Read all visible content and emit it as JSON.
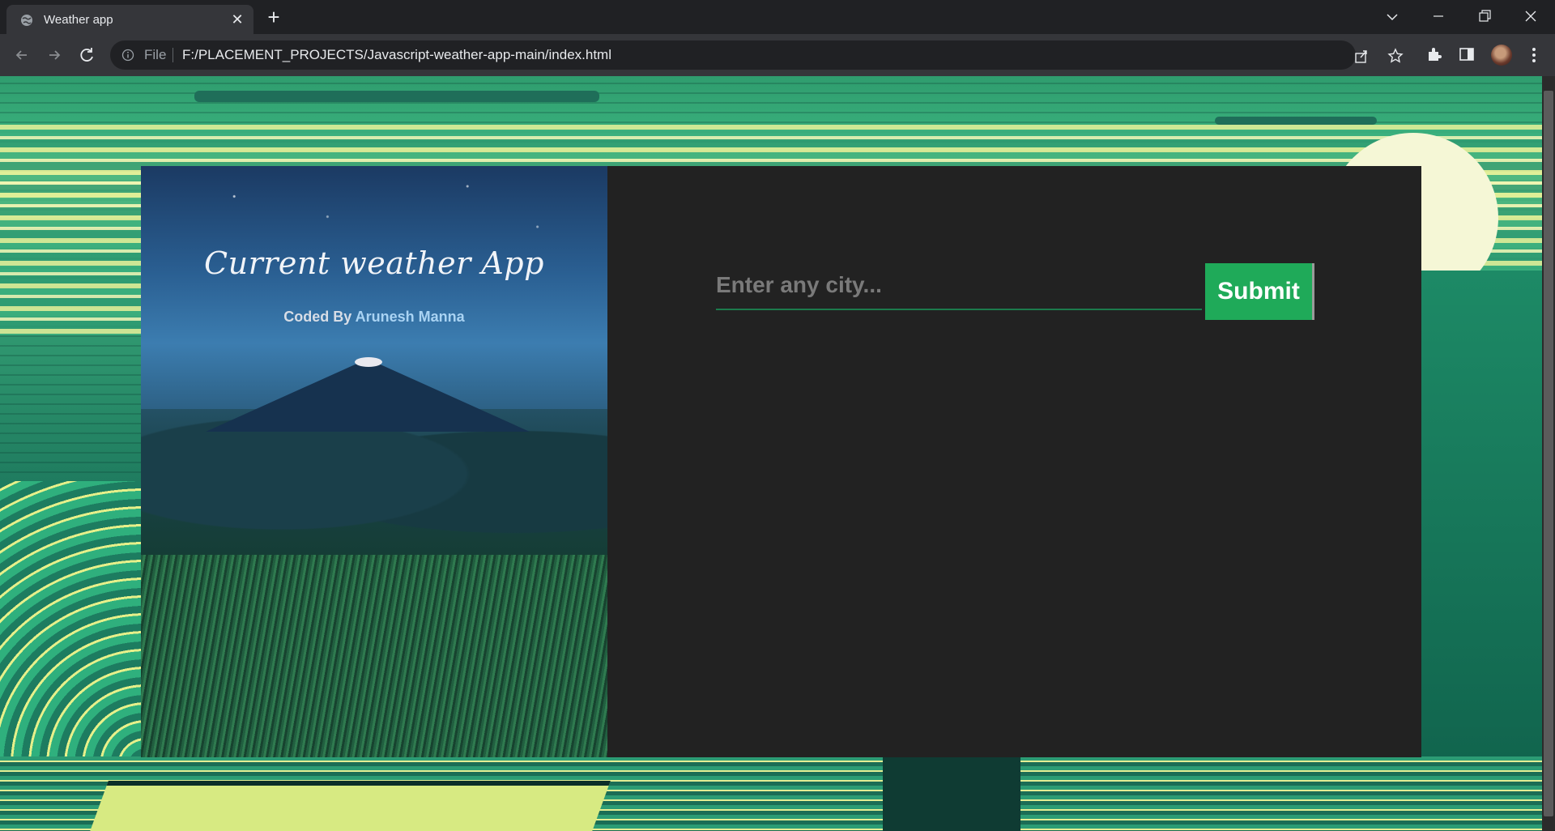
{
  "browser": {
    "tab_title": "Weather app",
    "url_scheme": "File",
    "url": "F:/PLACEMENT_PROJECTS/Javascript-weather-app-main/index.html",
    "icons": [
      "globe-icon",
      "close-icon",
      "plus-icon",
      "chevron-down-icon",
      "minimize-icon",
      "restore-icon",
      "window-close-icon",
      "back-icon",
      "forward-icon",
      "reload-icon",
      "info-icon",
      "share-icon",
      "star-icon",
      "extensions-icon",
      "side-panel-icon",
      "avatar",
      "menu-icon"
    ]
  },
  "app": {
    "title": "Current weather App",
    "credit_prefix": "Coded By",
    "credit_author": "Arunesh Manna",
    "search": {
      "placeholder": "Enter any city...",
      "value": ""
    },
    "submit_label": "Submit"
  },
  "colors": {
    "submit_bg": "#1faa59",
    "panel_bg": "#222222",
    "input_underline": "#1c7a4c"
  }
}
